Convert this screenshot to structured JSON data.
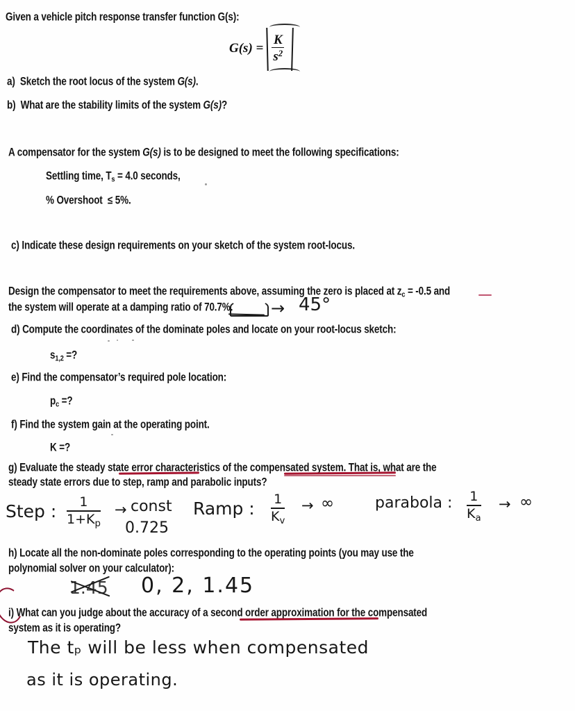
{
  "document": {
    "type": "scanned-homework-worksheet",
    "title_line": "Given a vehicle pitch response transfer function G(s):",
    "formula": {
      "lhs": "G(s) =",
      "numerator": "K",
      "denominator_base": "s",
      "denominator_exp": "2",
      "rendered": "G(s) = K / s^2"
    },
    "items": {
      "a_label": "a)",
      "a_text_1": "Sketch the root locus of the system ",
      "a_text_gs": "G(s)",
      "a_text_2": ".",
      "b_label": "b)",
      "b_text_1": "What are the stability limits of the system ",
      "b_text_gs": "G(s)",
      "b_text_2": "?",
      "c_label": "c)",
      "c_text": "Indicate these design requirements on your sketch of the system root-locus.",
      "d_label": "d)",
      "d_text": "Compute the coordinates of the dominate poles and locate on your root-locus sketch:",
      "d_answer_prompt_base": "s",
      "d_answer_prompt_sub": "1,2",
      "d_answer_prompt_tail": " =?",
      "e_label": "e)",
      "e_text": "Find the compensator’s required pole location:",
      "e_answer_prompt_base": "p",
      "e_answer_prompt_sub": "c",
      "e_answer_prompt_tail": " =?",
      "f_label": "f)",
      "f_text": "Find the system gain at the operating point.",
      "f_answer_prompt": "K =?",
      "g_label": "g)",
      "g_text_line1a": "Evaluate the steady ",
      "g_text_line1b": "state error characteristics",
      "g_text_line1c": " of the ",
      "g_text_line1d": "compensated system.",
      "g_text_line1e": "  That is, what are the",
      "g_text_line2": "steady state errors due to step, ramp and parabolic inputs?",
      "h_label": "h)",
      "h_text_line1": "Locate all the non-dominate poles corresponding to the operating points (you may use the",
      "h_text_line2": "polynomial solver on your calculator):",
      "i_label": "i)",
      "i_text_line1a": "What can you judge about the accuracy of a ",
      "i_text_line1b": "second order approximation",
      "i_text_line1c": " for the compensated",
      "i_text_line2": "system as it is operating?"
    },
    "compensator_intro": {
      "line": "A compensator for the system G(s) is to be designed to meet the following specifications:",
      "lead": "A compensator for the system ",
      "gs": "G(s)",
      "tail": " is to be designed to meet the following specifications:"
    },
    "specs": {
      "settling_time_label": "Settling time, T",
      "settling_time_sub": "s",
      "settling_time_value": " = 4.0 seconds,",
      "overshoot_label": "% Overshoot",
      "overshoot_value": "≤ 5%."
    },
    "design_paragraph": {
      "line1a": "Design the compensator to meet the requirements above, assuming the zero is placed at ",
      "line1_zc_base": "z",
      "line1_zc_sub": "c",
      "line1b": " = -0.5 and",
      "line2a": "the system will operate at a damping ratio of ",
      "line2_damping": "70.7%",
      "line2b": "."
    }
  },
  "annotations": {
    "damping_arrow": "→",
    "damping_angle": "45°",
    "step_label": "Step :",
    "step_num": "1",
    "step_den": "1+K",
    "step_den_sub": "p",
    "step_arrow": "→",
    "step_result": "const",
    "step_value": "0.725",
    "ramp_label": "Ramp :",
    "ramp_num": "1",
    "ramp_den": "K",
    "ramp_den_sub": "v",
    "ramp_arrow": "→",
    "ramp_result": "∞",
    "parabola_label": "parabola :",
    "parabola_num": "1",
    "parabola_den": "K",
    "parabola_den_sub": "a",
    "parabola_arrow": "→",
    "parabola_result": "∞",
    "poles_crossed_out": "1.45",
    "poles_answer": "0, 2, 1.45",
    "answer_i_line1": "The  tₚ  will  be  less  when  compensated",
    "answer_i_line2": "as   it   is   operating."
  },
  "colors": {
    "paper": "#fefefe",
    "print_ink": "#141414",
    "pen_ink": "#1b1b1b",
    "red_pen": "#a5142f",
    "red_circle": "#8e1331"
  }
}
